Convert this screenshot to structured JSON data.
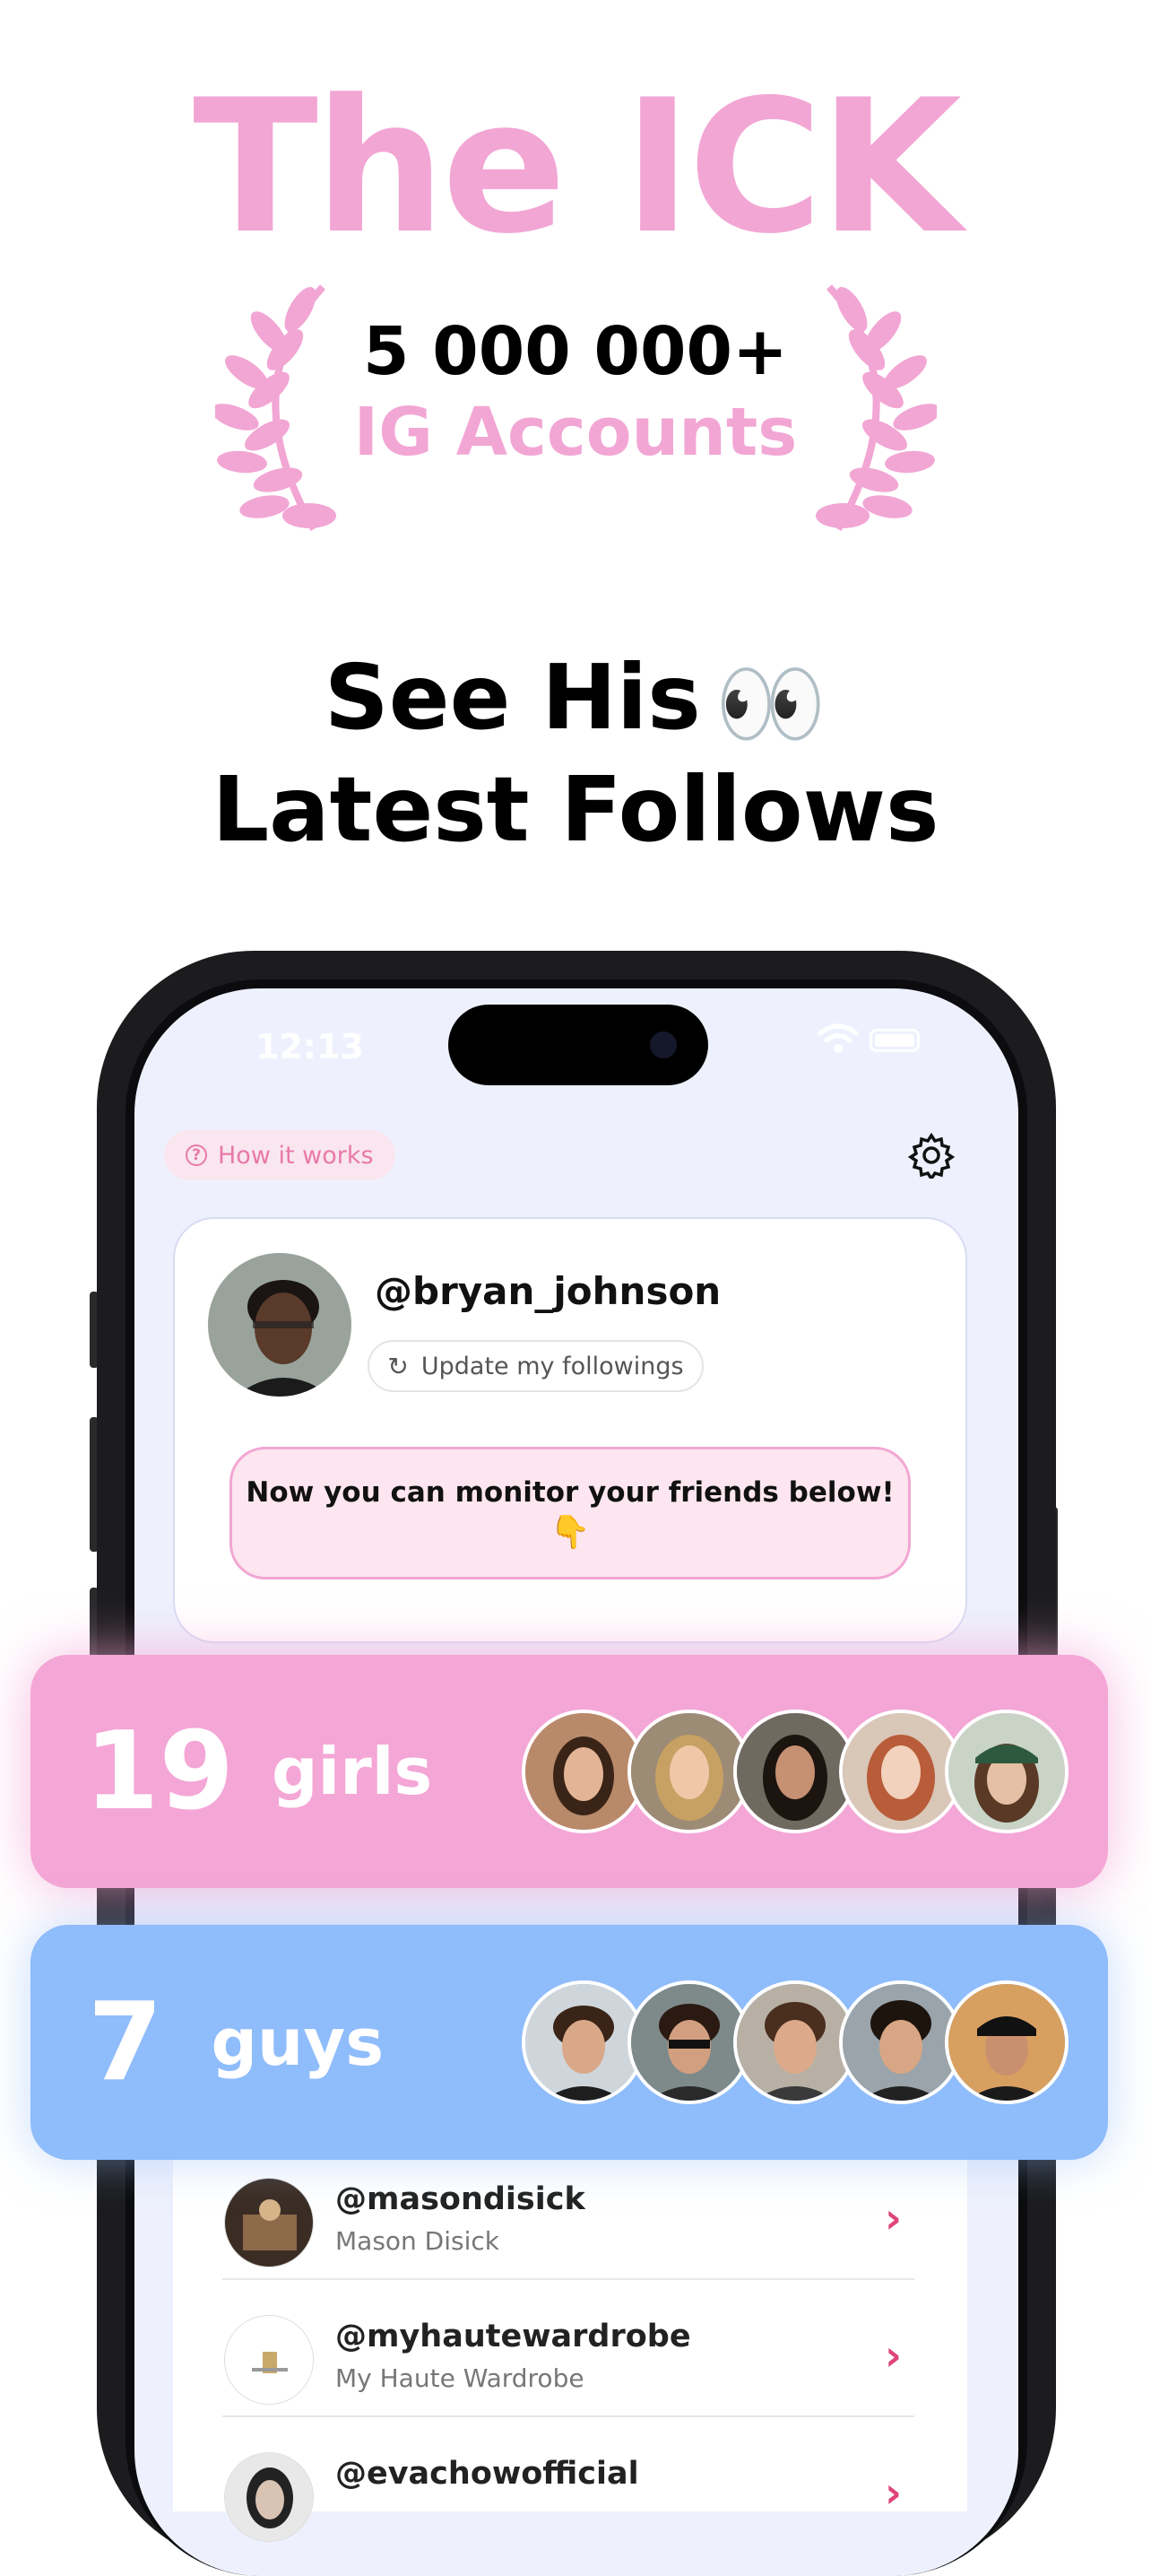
{
  "hero": {
    "title": "The ICK",
    "count": "5 000 000+",
    "subtitle": "IG Accounts"
  },
  "headline": {
    "line1": "See His",
    "eyes": "👀",
    "line2": "Latest Follows"
  },
  "status_bar": {
    "time": "12:13"
  },
  "app": {
    "how_it_works": "How it works",
    "username": "@bryan_johnson",
    "update_label": "Update my followings",
    "monitor_text": "Now you can monitor your friends below!",
    "monitor_emoji": "👇"
  },
  "banners": {
    "girls": {
      "count": "19",
      "label": "girls"
    },
    "guys": {
      "count": "7",
      "label": "guys"
    }
  },
  "list": [
    {
      "handle": "@masondisick",
      "name": "Mason Disick"
    },
    {
      "handle": "@myhautewardrobe",
      "name": "My Haute Wardrobe"
    },
    {
      "handle": "@evachowofficial",
      "name": ""
    }
  ],
  "colors": {
    "brand_pink": "#f2a6d4",
    "girls_banner": "#f4a6d6",
    "guys_banner": "#8fbcfb",
    "arrow": "#e0457a"
  },
  "icons": {
    "how_it_works": "question-circle-icon",
    "settings": "gear-icon",
    "update": "refresh-icon",
    "row_arrow": "chevron-right-icon"
  }
}
